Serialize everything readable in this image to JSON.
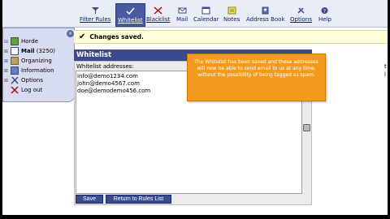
{
  "toolbar": {
    "items": [
      {
        "label": "Filter Rules",
        "icon": "filter-rules-icon"
      },
      {
        "label": "Whitelist",
        "icon": "check-icon",
        "active": true
      },
      {
        "label": "Blacklist",
        "icon": "blacklist-icon"
      },
      {
        "label": "Mail",
        "icon": "mail-icon"
      },
      {
        "label": "Calendar",
        "icon": "calendar-icon"
      },
      {
        "label": "Notes",
        "icon": "notes-icon"
      },
      {
        "label": "Address Book",
        "icon": "address-book-icon"
      },
      {
        "label": "Options",
        "icon": "options-icon"
      },
      {
        "label": "Help",
        "icon": "help-icon"
      }
    ]
  },
  "nav": {
    "items": [
      {
        "label": "Horde",
        "tree": "⊟",
        "icon": "horde-icon"
      },
      {
        "label": "Mail",
        "count": "(3250)",
        "tree": "⊞",
        "icon": "mail-icon"
      },
      {
        "label": "Organizing",
        "tree": "⊞",
        "icon": "organizing-icon"
      },
      {
        "label": "Information",
        "tree": "⊞",
        "icon": "information-icon"
      },
      {
        "label": "Options",
        "tree": "⊞",
        "icon": "options-icon"
      },
      {
        "label": "Log out",
        "tree": "",
        "icon": "logout-icon"
      }
    ]
  },
  "notice": {
    "message": "Changes saved."
  },
  "whitelist": {
    "title": "Whitelist",
    "label": "Whitelist addresses:",
    "addresses": "info@demo1234.com\njohn@demo4567.com\ndoe@demodemo456.com"
  },
  "buttons": {
    "save": "Save",
    "return": "Return to Rules List"
  },
  "tooltip": {
    "text": "The Whitelist has been saved and these addresses will now be able to send email to us at any time, without the possibility of being tagged as spam."
  },
  "colors": {
    "accent": "#3a4a8a",
    "tooltip": "#f39a1c",
    "notice": "#ffffd8"
  }
}
